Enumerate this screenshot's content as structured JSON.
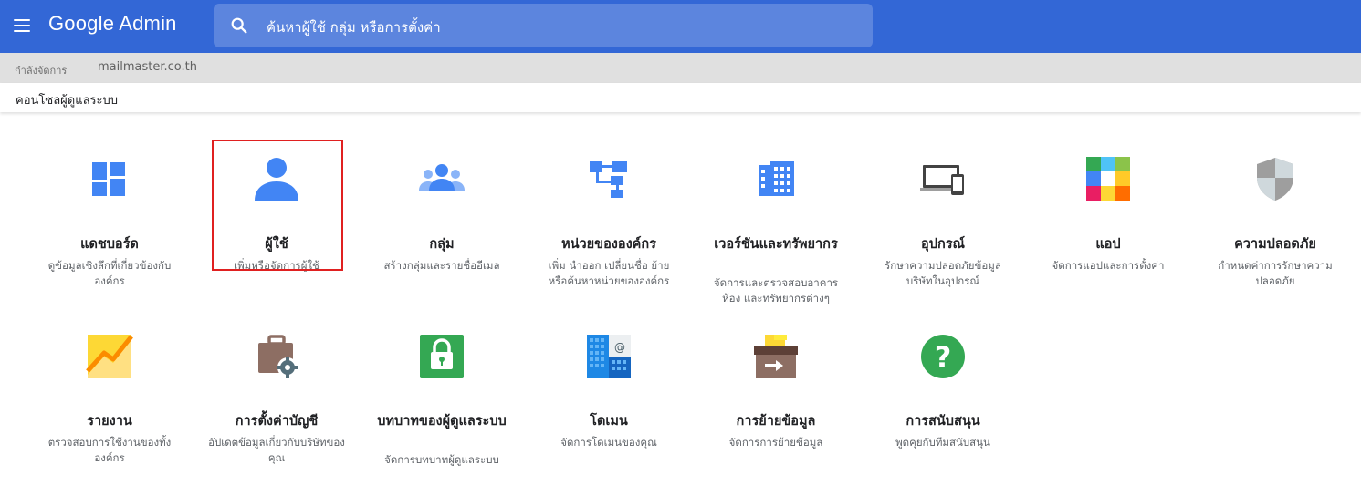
{
  "header": {
    "brand": "Google Admin",
    "search_placeholder": "ค้นหาผู้ใช้ กลุ่ม หรือการตั้งค่า"
  },
  "domain_bar": {
    "label": "กำลังจัดการ",
    "domain": "mailmaster.co.th"
  },
  "breadcrumb": "คอนโซลผู้ดูแลระบบ",
  "tiles_row1": [
    {
      "title": "แดชบอร์ด",
      "desc": "ดูข้อมูลเชิงลึกที่เกี่ยวข้องกับองค์กร",
      "icon": "dashboard-icon"
    },
    {
      "title": "ผู้ใช้",
      "desc": "เพิ่มหรือจัดการผู้ใช้",
      "icon": "user-icon",
      "highlighted": true
    },
    {
      "title": "กลุ่ม",
      "desc": "สร้างกลุ่มและรายชื่ออีเมล",
      "icon": "group-icon"
    },
    {
      "title": "หน่วยขององค์กร",
      "desc": "เพิ่ม นำออก เปลี่ยนชื่อ ย้าย หรือค้นหาหน่วยขององค์กร",
      "icon": "org-units-icon"
    },
    {
      "title": "เวอร์ชันและทรัพยากร",
      "desc": "จัดการและตรวจสอบอาคาร ห้อง และทรัพยากรต่างๆ",
      "icon": "building-icon"
    },
    {
      "title": "อุปกรณ์",
      "desc": "รักษาความปลอดภัยข้อมูลบริษัทในอุปกรณ์",
      "icon": "devices-icon"
    },
    {
      "title": "แอป",
      "desc": "จัดการแอปและการตั้งค่า",
      "icon": "apps-icon"
    },
    {
      "title": "ความปลอดภัย",
      "desc": "กำหนดค่าการรักษาความปลอดภัย",
      "icon": "security-shield-icon"
    }
  ],
  "tiles_row2": [
    {
      "title": "รายงาน",
      "desc": "ตรวจสอบการใช้งานของทั้งองค์กร",
      "icon": "reports-icon"
    },
    {
      "title": "การตั้งค่าบัญชี",
      "desc": "อัปเดตข้อมูลเกี่ยวกับบริษัทของคุณ",
      "icon": "account-settings-icon"
    },
    {
      "title": "บทบาทของผู้ดูแลระบบ",
      "desc": "จัดการบทบาทผู้ดูแลระบบ",
      "icon": "admin-roles-icon"
    },
    {
      "title": "โดเมน",
      "desc": "จัดการโดเมนของคุณ",
      "icon": "domains-icon"
    },
    {
      "title": "การย้ายข้อมูล",
      "desc": "จัดการการย้ายข้อมูล",
      "icon": "data-migration-icon"
    },
    {
      "title": "การสนับสนุน",
      "desc": "พูดคุยกับทีมสนับสนุน",
      "icon": "support-icon"
    }
  ]
}
